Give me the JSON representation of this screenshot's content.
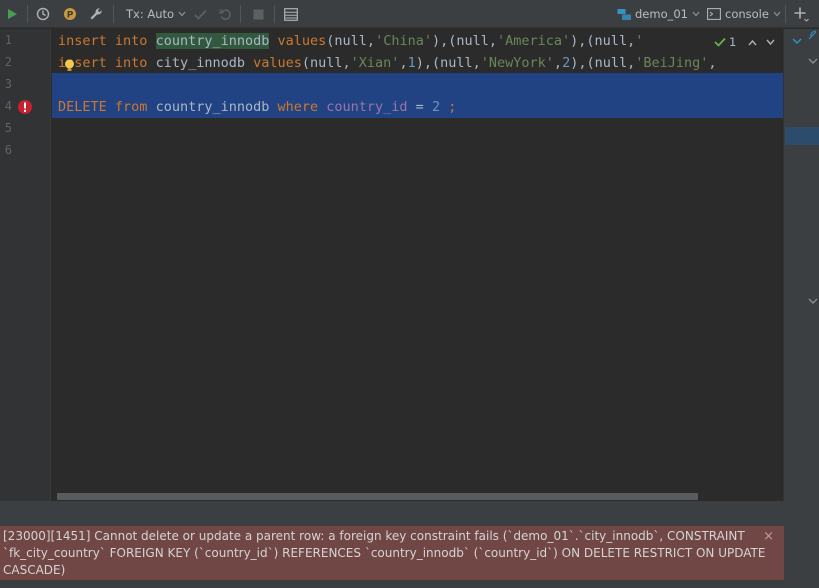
{
  "toolbar": {
    "tx_mode": "Tx: Auto",
    "datasource": "demo_01",
    "console": "console",
    "icons": [
      "run-icon",
      "history-icon",
      "profile-icon",
      "settings-wrench-icon",
      "commit-icon",
      "rollback-icon",
      "stop-icon",
      "results-table-icon",
      "datasource-icon",
      "console-icon",
      "add-icon"
    ]
  },
  "editor": {
    "line_numbers": [
      "1",
      "2",
      "3",
      "4",
      "5",
      "6"
    ],
    "inspection_count": "1",
    "lines": [
      [
        {
          "t": "insert",
          "c": "kw"
        },
        {
          "t": " "
        },
        {
          "t": "into",
          "c": "kw"
        },
        {
          "t": " "
        },
        {
          "t": "country_innodb",
          "c": "hl-id"
        },
        {
          "t": " "
        },
        {
          "t": "values",
          "c": "kw"
        },
        {
          "t": "(null,"
        },
        {
          "t": "'China'",
          "c": "str"
        },
        {
          "t": "),(null,"
        },
        {
          "t": "'America'",
          "c": "str"
        },
        {
          "t": "),(null,"
        },
        {
          "t": "'",
          "c": "str"
        }
      ],
      [
        {
          "t": "insert",
          "c": "kw"
        },
        {
          "t": " "
        },
        {
          "t": "into",
          "c": "kw"
        },
        {
          "t": " city_innodb "
        },
        {
          "t": "values",
          "c": "kw"
        },
        {
          "t": "(null,"
        },
        {
          "t": "'Xian'",
          "c": "str"
        },
        {
          "t": ","
        },
        {
          "t": "1",
          "c": "num"
        },
        {
          "t": "),(null,"
        },
        {
          "t": "'NewYork'",
          "c": "str"
        },
        {
          "t": ","
        },
        {
          "t": "2",
          "c": "num"
        },
        {
          "t": "),(null,"
        },
        {
          "t": "'BeiJing'",
          "c": "str"
        },
        {
          "t": ","
        }
      ],
      [],
      [
        {
          "t": "DELETE",
          "c": "kw"
        },
        {
          "t": " "
        },
        {
          "t": "from",
          "c": "kw"
        },
        {
          "t": " country_innodb "
        },
        {
          "t": "where",
          "c": "kw"
        },
        {
          "t": " "
        },
        {
          "t": "country_id",
          "c": "col"
        },
        {
          "t": " = "
        },
        {
          "t": "2",
          "c": "num"
        },
        {
          "t": " "
        },
        {
          "t": ";",
          "c": "kw"
        }
      ],
      [],
      []
    ]
  },
  "error": {
    "message": "[23000][1451] Cannot delete or update a parent row: a foreign key constraint fails (`demo_01`.`city_innodb`, CONSTRAINT `fk_city_country` FOREIGN KEY (`country_id`) REFERENCES `country_innodb` (`country_id`) ON DELETE RESTRICT ON UPDATE CASCADE)",
    "close_label": "×"
  },
  "colors": {
    "editor_bg": "#2b2b2b",
    "toolbar_bg": "#3c3f41",
    "selection": "#214283",
    "keyword": "#cc7832",
    "string": "#6a8759",
    "number": "#6897bb",
    "column": "#9876aa",
    "error_bg": "#704745"
  }
}
